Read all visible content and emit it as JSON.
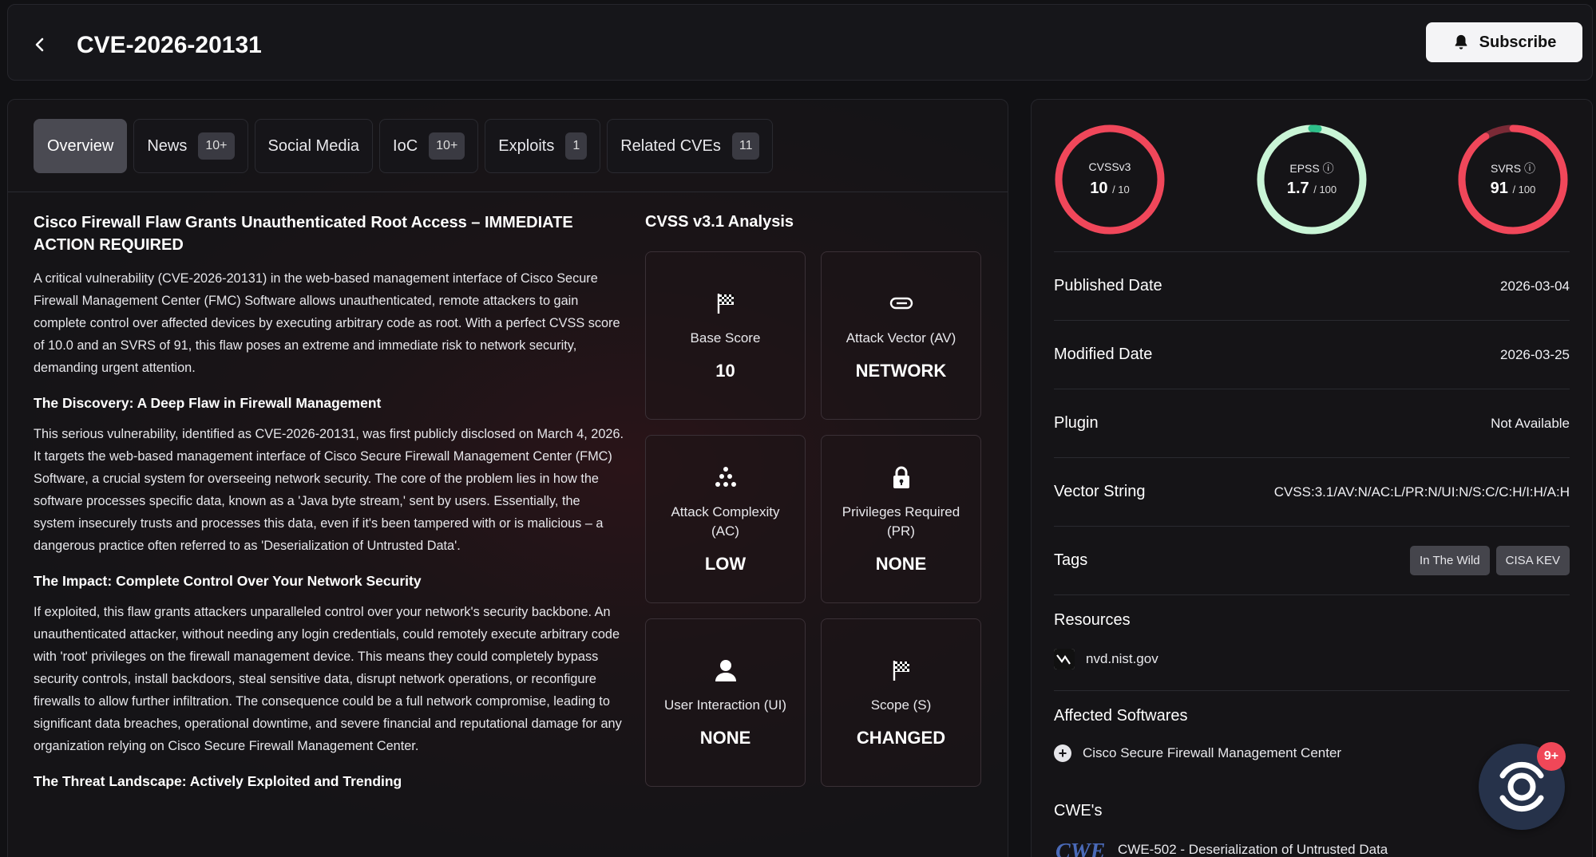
{
  "header": {
    "title": "CVE-2026-20131",
    "subscribe_label": "Subscribe"
  },
  "tabs": [
    {
      "label": "Overview",
      "badge": null,
      "active": true
    },
    {
      "label": "News",
      "badge": "10+"
    },
    {
      "label": "Social Media",
      "badge": null
    },
    {
      "label": "IoC",
      "badge": "10+"
    },
    {
      "label": "Exploits",
      "badge": "1"
    },
    {
      "label": "Related CVEs",
      "badge": "11"
    }
  ],
  "article": {
    "title": "Cisco Firewall Flaw Grants Unauthenticated Root Access – IMMEDIATE ACTION REQUIRED",
    "intro": "A critical vulnerability (CVE-2026-20131) in the web-based management interface of Cisco Secure Firewall Management Center (FMC) Software allows unauthenticated, remote attackers to gain complete control over affected devices by executing arbitrary code as root. With a perfect CVSS score of 10.0 and an SVRS of 91, this flaw poses an extreme and immediate risk to network security, demanding urgent attention.",
    "h_discovery": "The Discovery: A Deep Flaw in Firewall Management",
    "p_discovery": "This serious vulnerability, identified as CVE-2026-20131, was first publicly disclosed on March 4, 2026. It targets the web-based management interface of Cisco Secure Firewall Management Center (FMC) Software, a crucial system for overseeing network security. The core of the problem lies in how the software processes specific data, known as a 'Java byte stream,' sent by users. Essentially, the system insecurely trusts and processes this data, even if it's been tampered with or is malicious – a dangerous practice often referred to as 'Deserialization of Untrusted Data'.",
    "h_impact": "The Impact: Complete Control Over Your Network Security",
    "p_impact": "If exploited, this flaw grants attackers unparalleled control over your network's security backbone. An unauthenticated attacker, without needing any login credentials, could remotely execute arbitrary code with 'root' privileges on the firewall management device. This means they could completely bypass security controls, install backdoors, steal sensitive data, disrupt network operations, or reconfigure firewalls to allow further infiltration. The consequence could be a full network compromise, leading to significant data breaches, operational downtime, and severe financial and reputational damage for any organization relying on Cisco Secure Firewall Management Center.",
    "h_threat": "The Threat Landscape: Actively Exploited and Trending"
  },
  "cvss": {
    "title": "CVSS v3.1 Analysis",
    "metrics": [
      {
        "label": "Base Score",
        "value": "10",
        "icon": "flag-icon"
      },
      {
        "label": "Attack Vector (AV)",
        "value": "NETWORK",
        "icon": "link-icon"
      },
      {
        "label": "Attack Complexity (AC)",
        "value": "LOW",
        "icon": "complexity-icon"
      },
      {
        "label": "Privileges Required (PR)",
        "value": "NONE",
        "icon": "lock-icon"
      },
      {
        "label": "User Interaction (UI)",
        "value": "NONE",
        "icon": "user-icon"
      },
      {
        "label": "Scope (S)",
        "value": "CHANGED",
        "icon": "flag-icon"
      }
    ]
  },
  "gauges": [
    {
      "name": "CVSSv3",
      "value": "10",
      "max": "/ 10",
      "fraction": 1.0,
      "color": "#f0475a",
      "info": false
    },
    {
      "name": "EPSS",
      "value": "1.7",
      "max": "/ 100",
      "fraction": 0.017,
      "color": "#2ec08a",
      "track": "#c9f5d6",
      "info": true
    },
    {
      "name": "SVRS",
      "value": "91",
      "max": "/ 100",
      "fraction": 0.91,
      "color": "#f0475a",
      "info": true
    }
  ],
  "details": {
    "published_label": "Published Date",
    "published": "2026-03-04",
    "modified_label": "Modified Date",
    "modified": "2026-03-25",
    "plugin_label": "Plugin",
    "plugin": "Not Available",
    "vector_label": "Vector String",
    "vector": "CVSS:3.1/AV:N/AC:L/PR:N/UI:N/S:C/C:H/I:H/A:H",
    "tags_label": "Tags",
    "tags": [
      "In The Wild",
      "CISA KEV"
    ],
    "resources_label": "Resources",
    "resource": "nvd.nist.gov",
    "affected_label": "Affected Softwares",
    "affected": "Cisco Secure Firewall Management Center",
    "cwes_label": "CWE's",
    "cwe": "CWE-502 - Deserialization of Untrusted Data"
  },
  "chat": {
    "badge": "9+"
  },
  "colors": {
    "accent_red": "#f0475a",
    "accent_green": "#2ec08a",
    "bg": "#111114"
  }
}
